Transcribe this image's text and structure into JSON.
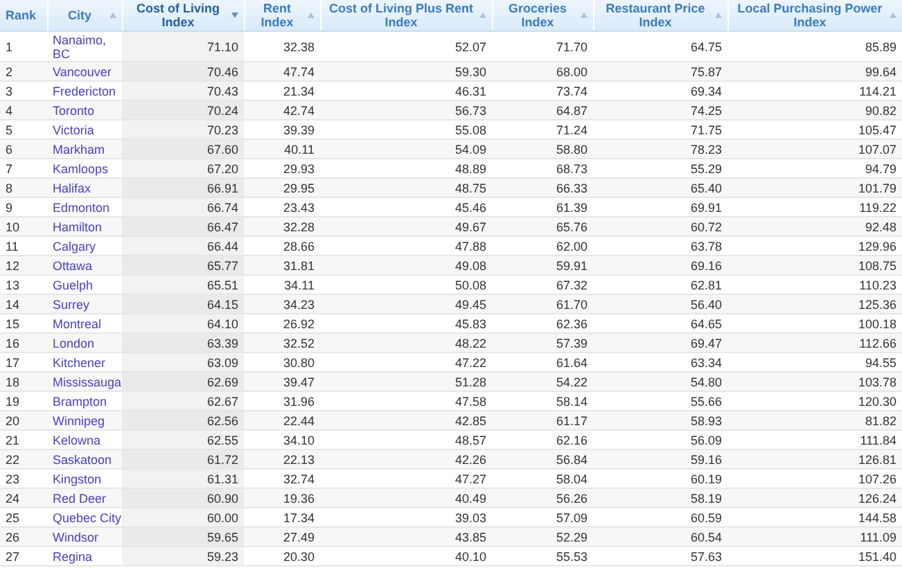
{
  "table": {
    "columns": [
      {
        "label": "Rank",
        "sortable": false,
        "sorted": false
      },
      {
        "label": "City",
        "sortable": true,
        "sorted": false
      },
      {
        "label": "Cost of Living Index",
        "sortable": true,
        "sorted": true
      },
      {
        "label": "Rent Index",
        "sortable": true,
        "sorted": false
      },
      {
        "label": "Cost of Living Plus Rent Index",
        "sortable": true,
        "sorted": false
      },
      {
        "label": "Groceries Index",
        "sortable": true,
        "sorted": false
      },
      {
        "label": "Restaurant Price Index",
        "sortable": true,
        "sorted": false
      },
      {
        "label": "Local Purchasing Power Index",
        "sortable": true,
        "sorted": false
      }
    ],
    "rows": [
      [
        "1",
        "Nanaimo, BC",
        "71.10",
        "32.38",
        "52.07",
        "71.70",
        "64.75",
        "85.89"
      ],
      [
        "2",
        "Vancouver",
        "70.46",
        "47.74",
        "59.30",
        "68.00",
        "75.87",
        "99.64"
      ],
      [
        "3",
        "Fredericton",
        "70.43",
        "21.34",
        "46.31",
        "73.74",
        "69.34",
        "114.21"
      ],
      [
        "4",
        "Toronto",
        "70.24",
        "42.74",
        "56.73",
        "64.87",
        "74.25",
        "90.82"
      ],
      [
        "5",
        "Victoria",
        "70.23",
        "39.39",
        "55.08",
        "71.24",
        "71.75",
        "105.47"
      ],
      [
        "6",
        "Markham",
        "67.60",
        "40.11",
        "54.09",
        "58.80",
        "78.23",
        "107.07"
      ],
      [
        "7",
        "Kamloops",
        "67.20",
        "29.93",
        "48.89",
        "68.73",
        "55.29",
        "94.79"
      ],
      [
        "8",
        "Halifax",
        "66.91",
        "29.95",
        "48.75",
        "66.33",
        "65.40",
        "101.79"
      ],
      [
        "9",
        "Edmonton",
        "66.74",
        "23.43",
        "45.46",
        "61.39",
        "69.91",
        "119.22"
      ],
      [
        "10",
        "Hamilton",
        "66.47",
        "32.28",
        "49.67",
        "65.76",
        "60.72",
        "92.48"
      ],
      [
        "11",
        "Calgary",
        "66.44",
        "28.66",
        "47.88",
        "62.00",
        "63.78",
        "129.96"
      ],
      [
        "12",
        "Ottawa",
        "65.77",
        "31.81",
        "49.08",
        "59.91",
        "69.16",
        "108.75"
      ],
      [
        "13",
        "Guelph",
        "65.51",
        "34.11",
        "50.08",
        "67.32",
        "62.81",
        "110.23"
      ],
      [
        "14",
        "Surrey",
        "64.15",
        "34.23",
        "49.45",
        "61.70",
        "56.40",
        "125.36"
      ],
      [
        "15",
        "Montreal",
        "64.10",
        "26.92",
        "45.83",
        "62.36",
        "64.65",
        "100.18"
      ],
      [
        "16",
        "London",
        "63.39",
        "32.52",
        "48.22",
        "57.39",
        "69.47",
        "112.66"
      ],
      [
        "17",
        "Kitchener",
        "63.09",
        "30.80",
        "47.22",
        "61.64",
        "63.34",
        "94.55"
      ],
      [
        "18",
        "Mississauga",
        "62.69",
        "39.47",
        "51.28",
        "54.22",
        "54.80",
        "103.78"
      ],
      [
        "19",
        "Brampton",
        "62.67",
        "31.96",
        "47.58",
        "58.14",
        "55.66",
        "120.30"
      ],
      [
        "20",
        "Winnipeg",
        "62.56",
        "22.44",
        "42.85",
        "61.17",
        "58.93",
        "81.82"
      ],
      [
        "21",
        "Kelowna",
        "62.55",
        "34.10",
        "48.57",
        "62.16",
        "56.09",
        "111.84"
      ],
      [
        "22",
        "Saskatoon",
        "61.72",
        "22.13",
        "42.26",
        "56.84",
        "59.16",
        "126.81"
      ],
      [
        "23",
        "Kingston",
        "61.31",
        "32.74",
        "47.27",
        "58.04",
        "60.19",
        "107.26"
      ],
      [
        "24",
        "Red Deer",
        "60.90",
        "19.36",
        "40.49",
        "56.26",
        "58.19",
        "126.24"
      ],
      [
        "25",
        "Quebec City",
        "60.00",
        "17.34",
        "39.03",
        "57.09",
        "60.59",
        "144.58"
      ],
      [
        "26",
        "Windsor",
        "59.65",
        "27.49",
        "43.85",
        "52.29",
        "60.54",
        "111.09"
      ],
      [
        "27",
        "Regina",
        "59.23",
        "20.30",
        "40.10",
        "55.53",
        "57.63",
        "151.40"
      ]
    ]
  }
}
